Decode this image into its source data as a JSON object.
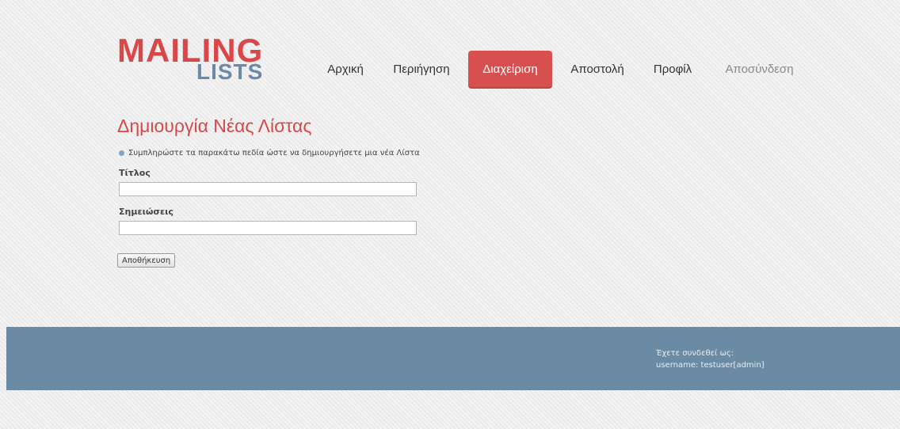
{
  "logo": {
    "line1": "MAILING",
    "line2": "LISTS"
  },
  "nav": {
    "items": [
      {
        "label": "Αρχική"
      },
      {
        "label": "Περιήγηση"
      },
      {
        "label": "Διαχείριση"
      },
      {
        "label": "Αποστολή"
      },
      {
        "label": "Προφίλ"
      },
      {
        "label": "Αποσύνδεση"
      }
    ],
    "active_label": "Διαχείριση"
  },
  "page": {
    "title": "Δημιουργία Νέας Λίστας",
    "info": "Συμπληρώστε τα παρακάτω πεδία ώστε να δημιουργήσετε μια νέα Λίστα",
    "fields": {
      "title_label": "Τίτλος",
      "title_value": "",
      "notes_label": "Σημειώσεις",
      "notes_value": ""
    },
    "save_label": "Αποθήκευση"
  },
  "footer": {
    "login_line1": "Έχετε συνδεθεί ως:",
    "login_line2": "username: testuser[admin]"
  },
  "colors": {
    "brand_red": "#d94848",
    "brand_blue": "#6a8aa8",
    "footer_bg": "#6b8ba4"
  }
}
